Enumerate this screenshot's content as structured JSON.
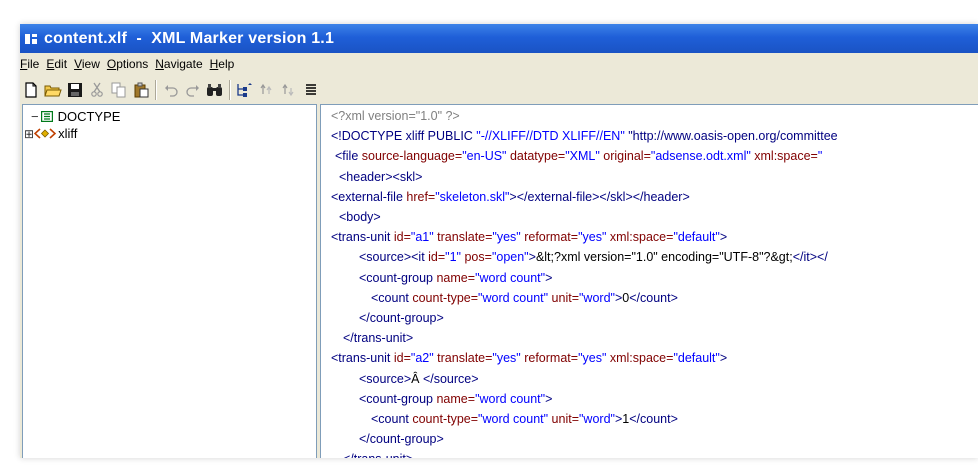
{
  "window": {
    "title": "content.xlf  -  XML Marker version 1.1"
  },
  "menu": [
    {
      "label": "File",
      "ul": "F",
      "rest": "ile"
    },
    {
      "label": "Edit",
      "ul": "E",
      "rest": "dit"
    },
    {
      "label": "View",
      "ul": "V",
      "rest": "iew"
    },
    {
      "label": "Options",
      "ul": "O",
      "rest": "ptions"
    },
    {
      "label": "Navigate",
      "ul": "N",
      "rest": "avigate"
    },
    {
      "label": "Help",
      "ul": "H",
      "rest": "elp"
    }
  ],
  "toolbar": {
    "icons": [
      "new-file-icon",
      "open-folder-icon",
      "save-icon",
      "cut-icon",
      "copy-icon",
      "paste-icon",
      "undo-icon",
      "redo-icon",
      "find-icon",
      "tree-sync-icon",
      "move-up-icon",
      "move-down-icon",
      "list-icon"
    ]
  },
  "tree": {
    "nodes": [
      {
        "expander": "−",
        "label": "DOCTYPE"
      },
      {
        "expander": "⊞",
        "label": "xliff"
      }
    ]
  },
  "code": {
    "lines": [
      {
        "indent": 0,
        "segs": [
          [
            "pi",
            "<?xml version=\"1.0\" ?>"
          ]
        ]
      },
      {
        "indent": 0,
        "segs": [
          [
            "tag",
            "<!DOCTYPE xliff PUBLIC "
          ],
          [
            "av",
            "\"-//XLIFF//DTD XLIFF//EN\""
          ],
          [
            "tag",
            " \"http://www.oasis-open.org/committee"
          ]
        ]
      },
      {
        "indent": 4,
        "segs": [
          [
            "tag",
            "<file "
          ],
          [
            "an",
            "source-language="
          ],
          [
            "av",
            "\"en-US\""
          ],
          [
            "an",
            " datatype="
          ],
          [
            "av",
            "\"XML\""
          ],
          [
            "an",
            " original="
          ],
          [
            "av",
            "\"adsense.odt.xml\""
          ],
          [
            "an",
            " xml:space="
          ],
          [
            "av",
            "\""
          ]
        ]
      },
      {
        "indent": 8,
        "segs": [
          [
            "tag",
            "<header><skl>"
          ]
        ]
      },
      {
        "indent": 0,
        "segs": [
          [
            "tag",
            "<external-file "
          ],
          [
            "an",
            "href="
          ],
          [
            "av",
            "\"skeleton.skl\""
          ],
          [
            "tag",
            "></external-file></skl></header>"
          ]
        ]
      },
      {
        "indent": 8,
        "segs": [
          [
            "tag",
            "<body>"
          ]
        ]
      },
      {
        "indent": 0,
        "segs": [
          [
            "tag",
            "<trans-unit "
          ],
          [
            "an",
            "id="
          ],
          [
            "av",
            "\"a1\""
          ],
          [
            "an",
            " translate="
          ],
          [
            "av",
            "\"yes\""
          ],
          [
            "an",
            " reformat="
          ],
          [
            "av",
            "\"yes\""
          ],
          [
            "an",
            " xml:space="
          ],
          [
            "av",
            "\"default\""
          ],
          [
            "tag",
            ">"
          ]
        ]
      },
      {
        "indent": 28,
        "segs": [
          [
            "tag",
            "<source><it "
          ],
          [
            "an",
            "id="
          ],
          [
            "av",
            "\"1\""
          ],
          [
            "an",
            " pos="
          ],
          [
            "av",
            "\"open\""
          ],
          [
            "tag",
            ">"
          ],
          [
            "txt",
            "&lt;?xml version=\"1.0\" encoding=\"UTF-8\"?&gt;"
          ],
          [
            "tag",
            "</it></"
          ]
        ]
      },
      {
        "indent": 28,
        "segs": [
          [
            "tag",
            "<count-group "
          ],
          [
            "an",
            "name="
          ],
          [
            "av",
            "\"word count\""
          ],
          [
            "tag",
            ">"
          ]
        ]
      },
      {
        "indent": 40,
        "segs": [
          [
            "tag",
            "<count "
          ],
          [
            "an",
            "count-type="
          ],
          [
            "av",
            "\"word count\""
          ],
          [
            "an",
            " unit="
          ],
          [
            "av",
            "\"word\""
          ],
          [
            "tag",
            ">"
          ],
          [
            "txt",
            "0"
          ],
          [
            "tag",
            "</count>"
          ]
        ]
      },
      {
        "indent": 28,
        "segs": [
          [
            "tag",
            "</count-group>"
          ]
        ]
      },
      {
        "indent": 12,
        "segs": [
          [
            "tag",
            "</trans-unit>"
          ]
        ]
      },
      {
        "indent": 0,
        "segs": [
          [
            "tag",
            "<trans-unit "
          ],
          [
            "an",
            "id="
          ],
          [
            "av",
            "\"a2\""
          ],
          [
            "an",
            " translate="
          ],
          [
            "av",
            "\"yes\""
          ],
          [
            "an",
            " reformat="
          ],
          [
            "av",
            "\"yes\""
          ],
          [
            "an",
            " xml:space="
          ],
          [
            "av",
            "\"default\""
          ],
          [
            "tag",
            ">"
          ]
        ]
      },
      {
        "indent": 28,
        "segs": [
          [
            "tag",
            "<source>"
          ],
          [
            "txt",
            "Â "
          ],
          [
            "tag",
            "</source>"
          ]
        ]
      },
      {
        "indent": 28,
        "segs": [
          [
            "tag",
            "<count-group "
          ],
          [
            "an",
            "name="
          ],
          [
            "av",
            "\"word count\""
          ],
          [
            "tag",
            ">"
          ]
        ]
      },
      {
        "indent": 40,
        "segs": [
          [
            "tag",
            "<count "
          ],
          [
            "an",
            "count-type="
          ],
          [
            "av",
            "\"word count\""
          ],
          [
            "an",
            " unit="
          ],
          [
            "av",
            "\"word\""
          ],
          [
            "tag",
            ">"
          ],
          [
            "txt",
            "1"
          ],
          [
            "tag",
            "</count>"
          ]
        ]
      },
      {
        "indent": 28,
        "segs": [
          [
            "tag",
            "</count-group>"
          ]
        ]
      },
      {
        "indent": 12,
        "segs": [
          [
            "tag",
            "</trans-unit>"
          ]
        ]
      }
    ]
  },
  "colors": {
    "titlebar": "#1f5fd8",
    "tag": "#000080",
    "attr_name": "#800000",
    "attr_value": "#0000ff"
  }
}
